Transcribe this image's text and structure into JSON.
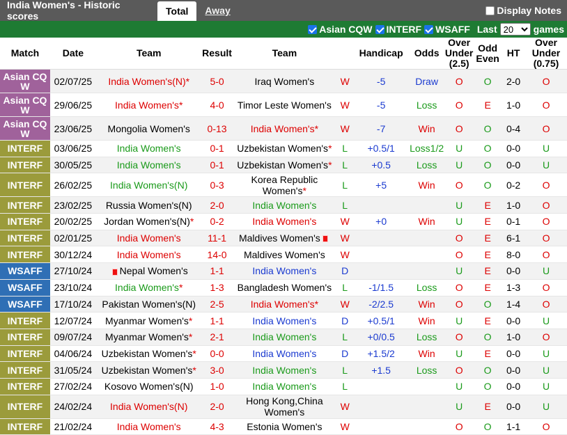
{
  "header": {
    "title": "India Women's - Historic scores",
    "tab_total": "Total",
    "tab_away": "Away",
    "display_notes": "Display Notes"
  },
  "filters": {
    "f1": "Asian CQW",
    "f2": "INTERF",
    "f3": "WSAFF",
    "last_label": "Last",
    "last_value": "20",
    "games_label": "games"
  },
  "columns": {
    "match": "Match",
    "date": "Date",
    "team1": "Team",
    "result": "Result",
    "team2": "Team",
    "handicap": "Handicap",
    "odds": "Odds",
    "ou25": "Over Under (2.5)",
    "oddeven": "Odd Even",
    "ht": "HT",
    "ou075": "Over Under (0.75)"
  },
  "colors": {
    "asian": "#a0629b",
    "interf": "#9b9b3b",
    "wsaff": "#2f6fb5",
    "topbar": "#5a5a5a",
    "filterbar": "#1e7b33"
  },
  "rows": [
    {
      "comp": "Asian CQ W",
      "ct": "asian",
      "date": "02/07/25",
      "home": "India Women's(N)",
      "hc": "red",
      "star1": true,
      "score": "5-0",
      "away": "Iraq Women's",
      "ac": "",
      "star2": false,
      "res": "W",
      "hcp": "-5",
      "odds": "Draw",
      "oc": "blue",
      "ou": "O",
      "oe": "O",
      "ht": "2-0",
      "ou2": "O",
      "tall": true
    },
    {
      "comp": "Asian CQ W",
      "ct": "asian",
      "date": "29/06/25",
      "home": "India Women's",
      "hc": "red",
      "star1": true,
      "score": "4-0",
      "away": "Timor Leste Women's",
      "ac": "",
      "star2": false,
      "res": "W",
      "hcp": "-5",
      "odds": "Loss",
      "oc": "green",
      "ou": "O",
      "oe": "E",
      "ht": "1-0",
      "ou2": "O",
      "tall": true
    },
    {
      "comp": "Asian CQ W",
      "ct": "asian",
      "date": "23/06/25",
      "home": "Mongolia Women's",
      "hc": "",
      "star1": false,
      "score": "0-13",
      "away": "India Women's",
      "ac": "red",
      "star2": true,
      "res": "W",
      "hcp": "-7",
      "odds": "Win",
      "oc": "red",
      "ou": "O",
      "oe": "O",
      "ht": "0-4",
      "ou2": "O",
      "tall": true
    },
    {
      "comp": "INTERF",
      "ct": "interf",
      "date": "03/06/25",
      "home": "India Women's",
      "hc": "green",
      "star1": false,
      "score": "0-1",
      "away": "Uzbekistan Women's",
      "ac": "",
      "star2": true,
      "res": "L",
      "hcp": "+0.5/1",
      "odds": "Loss1/2",
      "oc": "green",
      "ou": "U",
      "oe": "O",
      "ht": "0-0",
      "ou2": "U",
      "tall": false
    },
    {
      "comp": "INTERF",
      "ct": "interf",
      "date": "30/05/25",
      "home": "India Women's",
      "hc": "green",
      "star1": false,
      "score": "0-1",
      "away": "Uzbekistan Women's",
      "ac": "",
      "star2": true,
      "res": "L",
      "hcp": "+0.5",
      "odds": "Loss",
      "oc": "green",
      "ou": "U",
      "oe": "O",
      "ht": "0-0",
      "ou2": "U",
      "tall": false
    },
    {
      "comp": "INTERF",
      "ct": "interf",
      "date": "26/02/25",
      "home": "India Women's(N)",
      "hc": "green",
      "star1": false,
      "score": "0-3",
      "away": "Korea Republic Women's",
      "ac": "",
      "star2": true,
      "res": "L",
      "hcp": "+5",
      "odds": "Win",
      "oc": "red",
      "ou": "O",
      "oe": "O",
      "ht": "0-2",
      "ou2": "O",
      "tall": true
    },
    {
      "comp": "INTERF",
      "ct": "interf",
      "date": "23/02/25",
      "home": "Russia Women's(N)",
      "hc": "",
      "star1": false,
      "score": "2-0",
      "away": "India Women's",
      "ac": "green",
      "star2": false,
      "res": "L",
      "hcp": "",
      "odds": "",
      "oc": "",
      "ou": "U",
      "oe": "E",
      "ht": "1-0",
      "ou2": "O",
      "tall": false
    },
    {
      "comp": "INTERF",
      "ct": "interf",
      "date": "20/02/25",
      "home": "Jordan Women's(N)",
      "hc": "",
      "star1": true,
      "score": "0-2",
      "away": "India Women's",
      "ac": "red",
      "star2": false,
      "res": "W",
      "hcp": "+0",
      "odds": "Win",
      "oc": "red",
      "ou": "U",
      "oe": "E",
      "ht": "0-1",
      "ou2": "O",
      "tall": false
    },
    {
      "comp": "INTERF",
      "ct": "interf",
      "date": "02/01/25",
      "home": "India Women's",
      "hc": "red",
      "star1": false,
      "score": "11-1",
      "away": "Maldives Women's",
      "ac": "",
      "star2": false,
      "flag2": true,
      "res": "W",
      "hcp": "",
      "odds": "",
      "oc": "",
      "ou": "O",
      "oe": "E",
      "ht": "6-1",
      "ou2": "O",
      "tall": false
    },
    {
      "comp": "INTERF",
      "ct": "interf",
      "date": "30/12/24",
      "home": "India Women's",
      "hc": "red",
      "star1": false,
      "score": "14-0",
      "away": "Maldives Women's",
      "ac": "",
      "star2": false,
      "res": "W",
      "hcp": "",
      "odds": "",
      "oc": "",
      "ou": "O",
      "oe": "E",
      "ht": "8-0",
      "ou2": "O",
      "tall": false
    },
    {
      "comp": "WSAFF",
      "ct": "wsaff",
      "date": "27/10/24",
      "home": "Nepal Women's",
      "hc": "",
      "star1": false,
      "flag1": true,
      "score": "1-1",
      "away": "India Women's",
      "ac": "blue",
      "star2": false,
      "res": "D",
      "hcp": "",
      "odds": "",
      "oc": "",
      "ou": "U",
      "oe": "E",
      "ht": "0-0",
      "ou2": "U",
      "tall": false
    },
    {
      "comp": "WSAFF",
      "ct": "wsaff",
      "date": "23/10/24",
      "home": "India Women's",
      "hc": "green",
      "star1": true,
      "score": "1-3",
      "away": "Bangladesh Women's",
      "ac": "",
      "star2": false,
      "res": "L",
      "hcp": "-1/1.5",
      "odds": "Loss",
      "oc": "green",
      "ou": "O",
      "oe": "E",
      "ht": "1-3",
      "ou2": "O",
      "tall": false
    },
    {
      "comp": "WSAFF",
      "ct": "wsaff",
      "date": "17/10/24",
      "home": "Pakistan Women's(N)",
      "hc": "",
      "star1": false,
      "score": "2-5",
      "away": "India Women's",
      "ac": "red",
      "star2": true,
      "res": "W",
      "hcp": "-2/2.5",
      "odds": "Win",
      "oc": "red",
      "ou": "O",
      "oe": "O",
      "ht": "1-4",
      "ou2": "O",
      "tall": false
    },
    {
      "comp": "INTERF",
      "ct": "interf",
      "date": "12/07/24",
      "home": "Myanmar Women's",
      "hc": "",
      "star1": true,
      "score": "1-1",
      "away": "India Women's",
      "ac": "blue",
      "star2": false,
      "res": "D",
      "hcp": "+0.5/1",
      "odds": "Win",
      "oc": "red",
      "ou": "U",
      "oe": "E",
      "ht": "0-0",
      "ou2": "U",
      "tall": false
    },
    {
      "comp": "INTERF",
      "ct": "interf",
      "date": "09/07/24",
      "home": "Myanmar Women's",
      "hc": "",
      "star1": true,
      "score": "2-1",
      "away": "India Women's",
      "ac": "green",
      "star2": false,
      "res": "L",
      "hcp": "+0/0.5",
      "odds": "Loss",
      "oc": "green",
      "ou": "O",
      "oe": "O",
      "ht": "1-0",
      "ou2": "O",
      "tall": false
    },
    {
      "comp": "INTERF",
      "ct": "interf",
      "date": "04/06/24",
      "home": "Uzbekistan Women's",
      "hc": "",
      "star1": true,
      "score": "0-0",
      "away": "India Women's",
      "ac": "blue",
      "star2": false,
      "res": "D",
      "hcp": "+1.5/2",
      "odds": "Win",
      "oc": "red",
      "ou": "U",
      "oe": "E",
      "ht": "0-0",
      "ou2": "U",
      "tall": false
    },
    {
      "comp": "INTERF",
      "ct": "interf",
      "date": "31/05/24",
      "home": "Uzbekistan Women's",
      "hc": "",
      "star1": true,
      "score": "3-0",
      "away": "India Women's",
      "ac": "green",
      "star2": false,
      "res": "L",
      "hcp": "+1.5",
      "odds": "Loss",
      "oc": "green",
      "ou": "O",
      "oe": "O",
      "ht": "0-0",
      "ou2": "U",
      "tall": false
    },
    {
      "comp": "INTERF",
      "ct": "interf",
      "date": "27/02/24",
      "home": "Kosovo Women's(N)",
      "hc": "",
      "star1": false,
      "score": "1-0",
      "away": "India Women's",
      "ac": "green",
      "star2": false,
      "res": "L",
      "hcp": "",
      "odds": "",
      "oc": "",
      "ou": "U",
      "oe": "O",
      "ht": "0-0",
      "ou2": "U",
      "tall": false
    },
    {
      "comp": "INTERF",
      "ct": "interf",
      "date": "24/02/24",
      "home": "India Women's(N)",
      "hc": "red",
      "star1": false,
      "score": "2-0",
      "away": "Hong Kong,China Women's",
      "ac": "",
      "star2": false,
      "res": "W",
      "hcp": "",
      "odds": "",
      "oc": "",
      "ou": "U",
      "oe": "E",
      "ht": "0-0",
      "ou2": "U",
      "tall": true
    },
    {
      "comp": "INTERF",
      "ct": "interf",
      "date": "21/02/24",
      "home": "India Women's",
      "hc": "red",
      "star1": false,
      "score": "4-3",
      "away": "Estonia Women's",
      "ac": "",
      "star2": false,
      "res": "W",
      "hcp": "",
      "odds": "",
      "oc": "",
      "ou": "O",
      "oe": "O",
      "ht": "1-1",
      "ou2": "O",
      "tall": false
    }
  ]
}
